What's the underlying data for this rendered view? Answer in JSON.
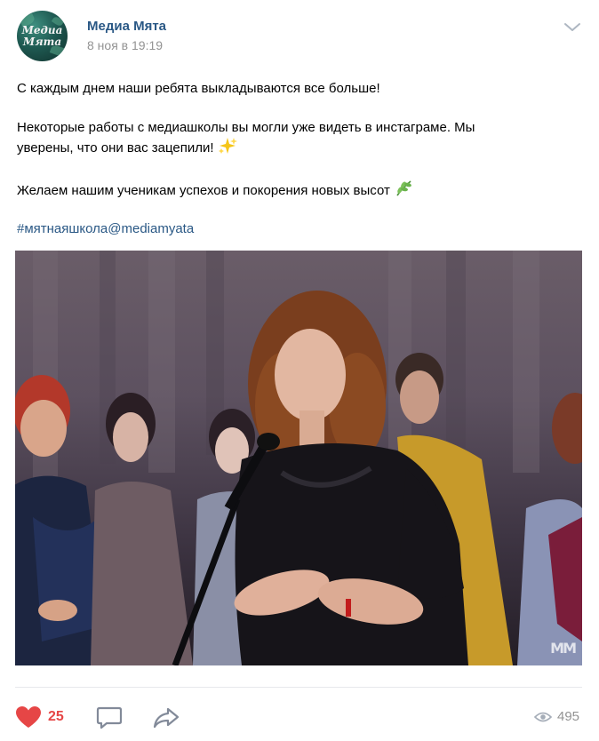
{
  "post": {
    "author": "Медиа Мята",
    "date": "8 ноя в 19:19",
    "avatar_text_line1": "Медиа",
    "avatar_text_line2": "Мята",
    "text_line1": "С каждым днем наши ребята выкладываются все больше!",
    "text_line2a": "Некоторые работы с медиашколы вы могли уже видеть в инстаграме. Мы",
    "text_line2b": "уверены, что они вас зацепили!",
    "text_line3": "Желаем нашим ученикам успехов и покорения новых высот",
    "hashtag": "#мятнаяшкола@mediamyata",
    "photo_watermark": "MM",
    "icons": {
      "menu": "chevron-down-icon",
      "sparkles": "sparkles-icon",
      "herb": "herb-icon",
      "like": "heart-icon",
      "comment": "comment-icon",
      "share": "share-arrow-icon",
      "views": "eye-icon"
    }
  },
  "actions": {
    "likes": "25",
    "views": "495"
  },
  "colors": {
    "link": "#2a5885",
    "muted": "#939393",
    "like": "#e64646",
    "icon": "#828a99",
    "divider": "#e7e8ec"
  }
}
